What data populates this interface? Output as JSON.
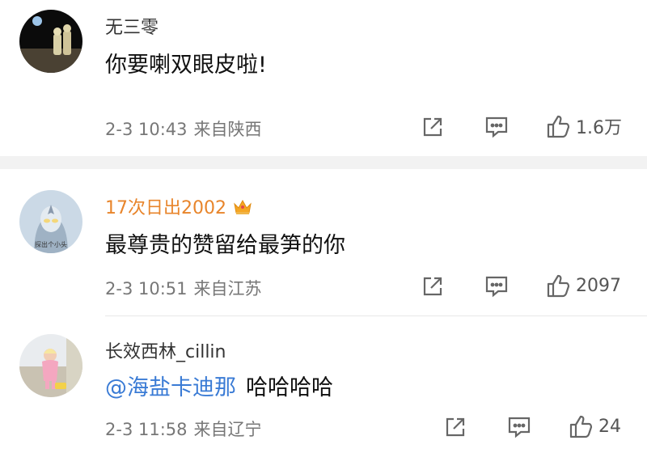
{
  "comments": [
    {
      "username": "无三零",
      "text": "你要喇双眼皮啦!",
      "time": "2-3 10:43",
      "location": "来自陕西",
      "likes": "1.6万"
    },
    {
      "username": "17次日出2002",
      "text": "最尊贵的赞留给最笋的你",
      "time": "2-3 10:51",
      "location": "来自江苏",
      "likes": "2097",
      "avatar_caption": "探出个小头",
      "badge_icon": "crown-icon"
    },
    {
      "username": "长效西林_cillin",
      "mention": "@海盐卡迪那",
      "text": "哈哈哈哈",
      "time": "2-3 11:58",
      "location": "来自辽宁",
      "likes": "24"
    }
  ],
  "colors": {
    "vip_name": "#e8852b",
    "mention": "#3a7bd5",
    "meta": "#777777",
    "divider": "#f2f2f2"
  }
}
